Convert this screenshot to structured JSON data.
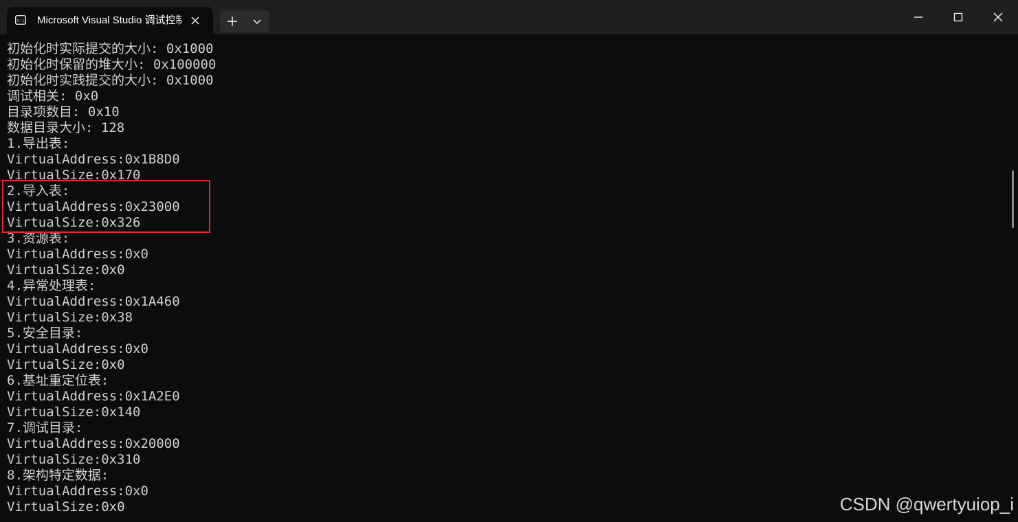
{
  "window": {
    "tab_title": "Microsoft Visual Studio 调试控制台",
    "tab_icon": "terminal-icon",
    "buttons": {
      "new_tab": "plus-icon",
      "tab_dropdown": "chevron-down-icon",
      "minimize": "minimize-icon",
      "maximize": "maximize-icon",
      "close": "close-icon"
    }
  },
  "console": {
    "lines": [
      "初始化时实际提交的大小: 0x1000",
      "初始化时保留的堆大小: 0x100000",
      "初始化时实践提交的大小: 0x1000",
      "调试相关: 0x0",
      "目录项数目: 0x10",
      "数据目录大小: 128",
      "1.导出表:",
      "VirtualAddress:0x1B8D0",
      "VirtualSize:0x170",
      "2.导入表:",
      "VirtualAddress:0x23000",
      "VirtualSize:0x326",
      "3.资源表:",
      "VirtualAddress:0x0",
      "VirtualSize:0x0",
      "4.异常处理表:",
      "VirtualAddress:0x1A460",
      "VirtualSize:0x38",
      "5.安全目录:",
      "VirtualAddress:0x0",
      "VirtualSize:0x0",
      "6.基址重定位表:",
      "VirtualAddress:0x1A2E0",
      "VirtualSize:0x140",
      "7.调试目录:",
      "VirtualAddress:0x20000",
      "VirtualSize:0x310",
      "8.架构特定数据:",
      "VirtualAddress:0x0",
      "VirtualSize:0x0"
    ],
    "highlight_color": "#e02a2a"
  },
  "watermark": "CSDN @qwertyuiop_i"
}
